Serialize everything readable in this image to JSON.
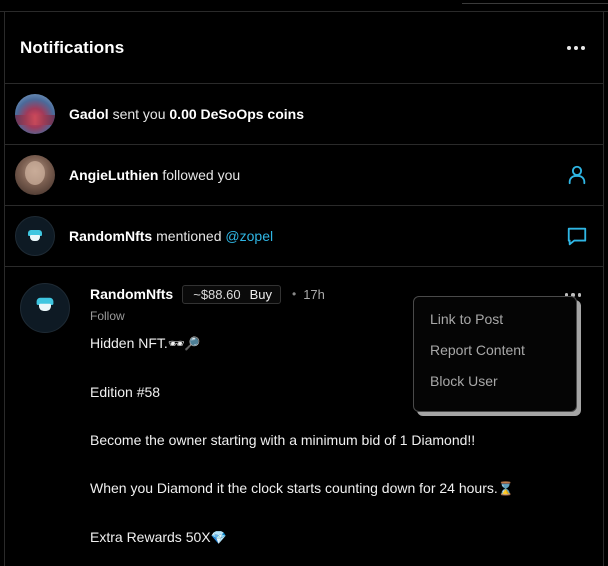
{
  "header": {
    "title": "Notifications",
    "more_icon": "more-horizontal-icon"
  },
  "notifications": [
    {
      "actor": "Gadol",
      "action": "sent you",
      "object": "0.00 DeSoOps coins",
      "avatar": "sky-photo"
    },
    {
      "actor": "AngieLuthien",
      "action": "followed you",
      "icon": "user-icon"
    },
    {
      "actor": "RandomNfts",
      "action": "mentioned",
      "mention": "@zopel",
      "icon": "chat-bubble-icon"
    }
  ],
  "post": {
    "author": "RandomNfts",
    "price": "~$88.60",
    "buy_label": "Buy",
    "separator": "•",
    "time": "17h",
    "follow_label": "Follow",
    "lines": [
      "Hidden NFT.",
      "Edition #58",
      "Become the owner starting with a minimum bid of 1 Diamond!!",
      "When you Diamond it the clock starts counting down for 24 hours.",
      "Extra Rewards 50X"
    ],
    "emojis": {
      "line1": "🕶🔎",
      "line4": "⌛",
      "line5": "💎"
    }
  },
  "context_menu": {
    "items": [
      "Link to Post",
      "Report Content",
      "Block User"
    ]
  },
  "colors": {
    "accent": "#2fb6e4",
    "background": "#000000",
    "border": "#2a2a2a"
  }
}
